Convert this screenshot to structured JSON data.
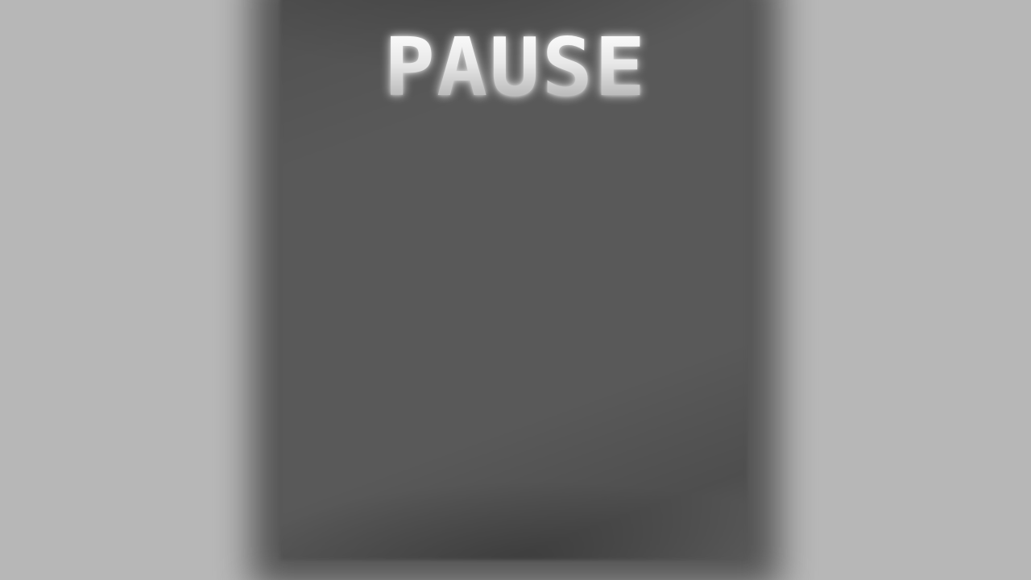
{
  "pause_menu": {
    "title": "PAUSE"
  },
  "colors": {
    "background": "#b7b7b7",
    "panel": "#595959",
    "title_text": "#f2f2f2"
  }
}
